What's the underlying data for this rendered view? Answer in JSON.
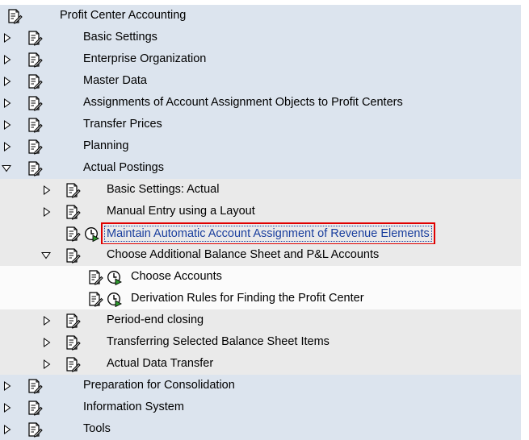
{
  "tree": {
    "root": {
      "label": "Profit Center Accounting"
    },
    "items": [
      {
        "label": "Basic Settings"
      },
      {
        "label": "Enterprise Organization"
      },
      {
        "label": "Master Data"
      },
      {
        "label": "Assignments of Account Assignment Objects to Profit Centers"
      },
      {
        "label": "Transfer Prices"
      },
      {
        "label": "Planning"
      },
      {
        "label": "Actual Postings"
      },
      {
        "label": "Basic Settings: Actual"
      },
      {
        "label": "Manual Entry using a Layout"
      },
      {
        "label": "Maintain Automatic Account Assignment of Revenue Elements"
      },
      {
        "label": "Choose Additional Balance Sheet and P&L Accounts"
      },
      {
        "label": "Choose Accounts"
      },
      {
        "label": "Derivation Rules for Finding the Profit Center"
      },
      {
        "label": "Period-end closing"
      },
      {
        "label": "Transferring Selected Balance Sheet Items"
      },
      {
        "label": "Actual Data Transfer"
      },
      {
        "label": "Preparation for Consolidation"
      },
      {
        "label": "Information System"
      },
      {
        "label": "Tools"
      }
    ]
  },
  "colors": {
    "level0_bg": "#dce4ee",
    "level1_bg": "#eaeaea",
    "level2_bg": "#fbfbfb",
    "selected_text": "#1a3f9e",
    "highlight_border": "#e00000"
  },
  "icons": {
    "expand": "triangle-right-icon",
    "collapse": "triangle-down-icon",
    "document": "document-pencil-icon",
    "execute": "clock-execute-icon"
  }
}
